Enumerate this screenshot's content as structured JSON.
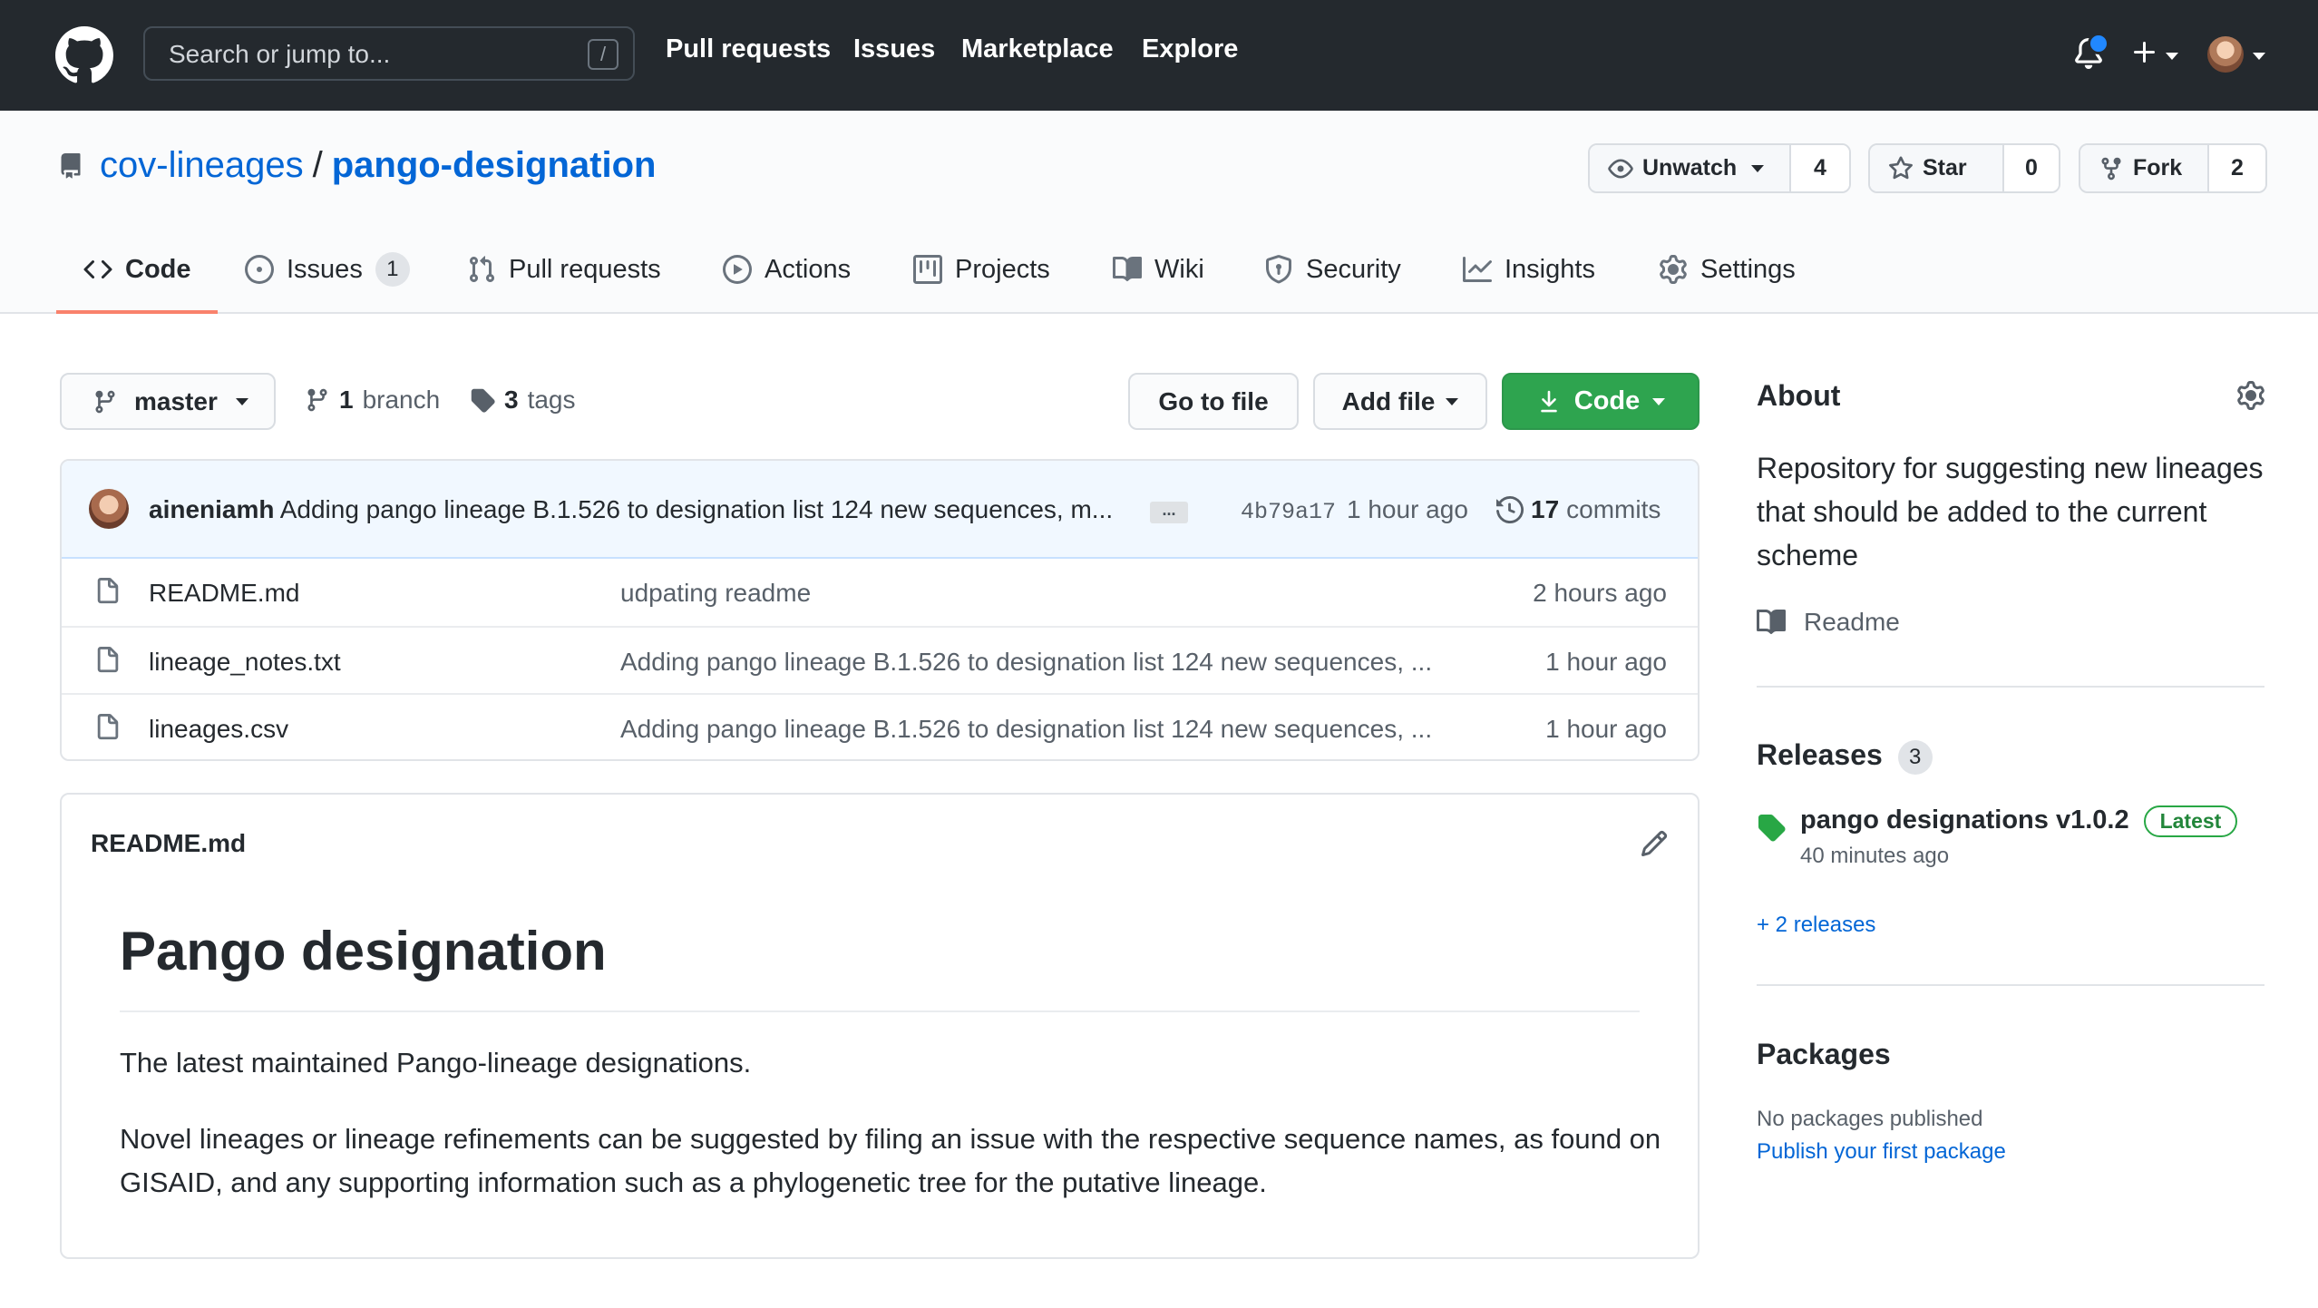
{
  "topbar": {
    "search_placeholder": "Search or jump to...",
    "search_shortcut": "/",
    "nav": [
      "Pull requests",
      "Issues",
      "Marketplace",
      "Explore"
    ]
  },
  "repo": {
    "owner": "cov-lineages",
    "separator": "/",
    "name": "pango-designation",
    "watch_label": "Unwatch",
    "watch_count": "4",
    "star_label": "Star",
    "star_count": "0",
    "fork_label": "Fork",
    "fork_count": "2"
  },
  "tabs": [
    {
      "label": "Code",
      "active": true,
      "icon": "code-icon"
    },
    {
      "label": "Issues",
      "counter": "1",
      "icon": "issue-opened-icon"
    },
    {
      "label": "Pull requests",
      "icon": "git-pull-request-icon"
    },
    {
      "label": "Actions",
      "icon": "play-icon"
    },
    {
      "label": "Projects",
      "icon": "project-icon"
    },
    {
      "label": "Wiki",
      "icon": "book-icon"
    },
    {
      "label": "Security",
      "icon": "shield-icon"
    },
    {
      "label": "Insights",
      "icon": "graph-icon"
    },
    {
      "label": "Settings",
      "icon": "gear-icon"
    }
  ],
  "branchbar": {
    "branch": "master",
    "branch_count": "1",
    "branch_word": "branch",
    "tag_count": "3",
    "tag_word": "tags",
    "goto_file": "Go to file",
    "add_file": "Add file",
    "code": "Code"
  },
  "latest_commit": {
    "author": "aineniamh",
    "message": "Adding pango lineage B.1.526 to designation list 124 new sequences, m...",
    "ellipsis": "...",
    "sha": "4b79a17",
    "time": "1 hour ago",
    "commit_count": "17",
    "commit_word": "commits"
  },
  "files": [
    {
      "name": "README.md",
      "message": "udpating readme",
      "time": "2 hours ago"
    },
    {
      "name": "lineage_notes.txt",
      "message": "Adding pango lineage B.1.526 to designation list 124 new sequences, ...",
      "time": "1 hour ago"
    },
    {
      "name": "lineages.csv",
      "message": "Adding pango lineage B.1.526 to designation list 124 new sequences, ...",
      "time": "1 hour ago"
    }
  ],
  "readme": {
    "filename": "README.md",
    "heading": "Pango designation",
    "p1": "The latest maintained Pango-lineage designations.",
    "p2": "Novel lineages or lineage refinements can be suggested by filing an issue with the respective sequence names, as found on GISAID, and any supporting information such as a phylogenetic tree for the putative lineage."
  },
  "sidebar": {
    "about_title": "About",
    "about_text": "Repository for suggesting new lineages that should be added to the current scheme",
    "readme_link": "Readme",
    "releases_title": "Releases",
    "releases_count": "3",
    "release_name": "pango designations v1.0.2",
    "release_badge": "Latest",
    "release_time": "40 minutes ago",
    "more_releases": "+ 2 releases",
    "packages_title": "Packages",
    "packages_none": "No packages published",
    "packages_link": "Publish your first package"
  },
  "colors": {
    "topbar_bg": "#24292e",
    "link_blue": "#0366d6",
    "code_button_green": "#2ea44f",
    "active_tab_underline": "#f9826c",
    "notification_dot": "#2188ff"
  }
}
